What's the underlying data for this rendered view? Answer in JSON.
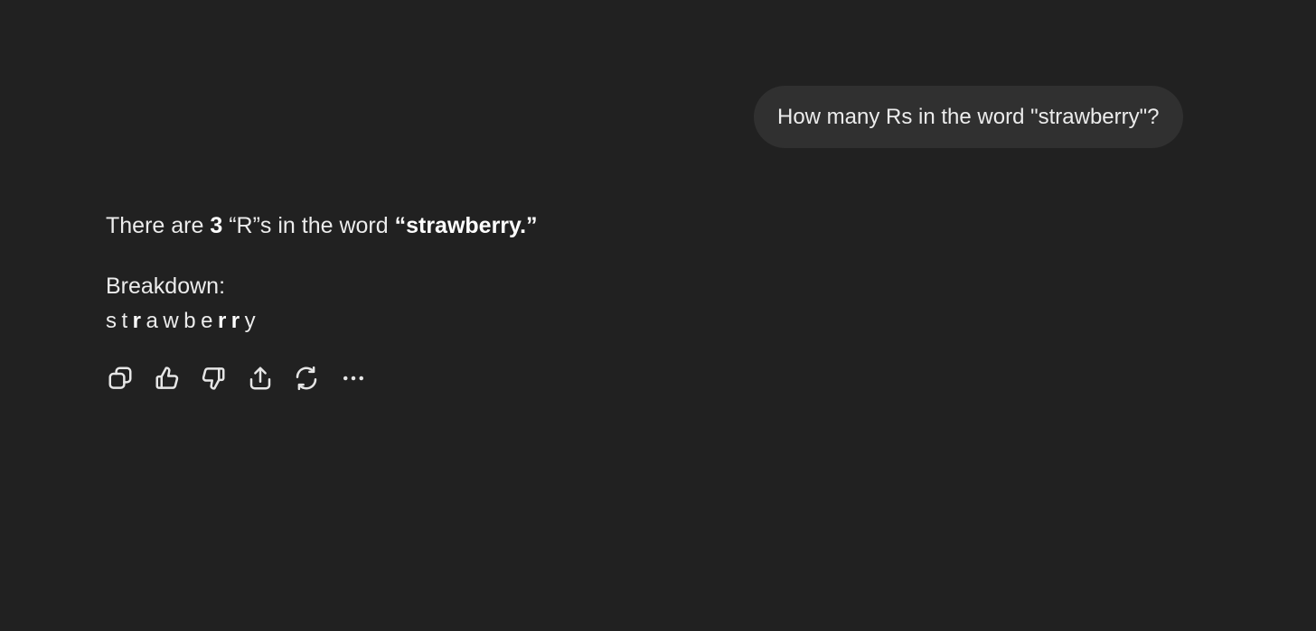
{
  "user_message": "How many Rs in the word \"strawberry\"?",
  "assistant": {
    "answer": {
      "prefix": "There are ",
      "count": "3",
      "middle": " “R”s in the word ",
      "word": "“strawberry.”"
    },
    "breakdown_label": "Breakdown:",
    "letters": [
      {
        "char": "s",
        "highlight": false
      },
      {
        "char": "t",
        "highlight": false
      },
      {
        "char": "r",
        "highlight": true
      },
      {
        "char": "a",
        "highlight": false
      },
      {
        "char": "w",
        "highlight": false
      },
      {
        "char": "b",
        "highlight": false
      },
      {
        "char": "e",
        "highlight": false
      },
      {
        "char": "r",
        "highlight": true
      },
      {
        "char": "r",
        "highlight": true
      },
      {
        "char": "y",
        "highlight": false
      }
    ]
  },
  "actions": [
    {
      "icon": "copy-icon"
    },
    {
      "icon": "thumbs-up-icon"
    },
    {
      "icon": "thumbs-down-icon"
    },
    {
      "icon": "share-icon"
    },
    {
      "icon": "regenerate-icon"
    },
    {
      "icon": "more-icon"
    }
  ],
  "colors": {
    "background": "#212121",
    "bubble": "#303030",
    "text": "#ececec"
  }
}
